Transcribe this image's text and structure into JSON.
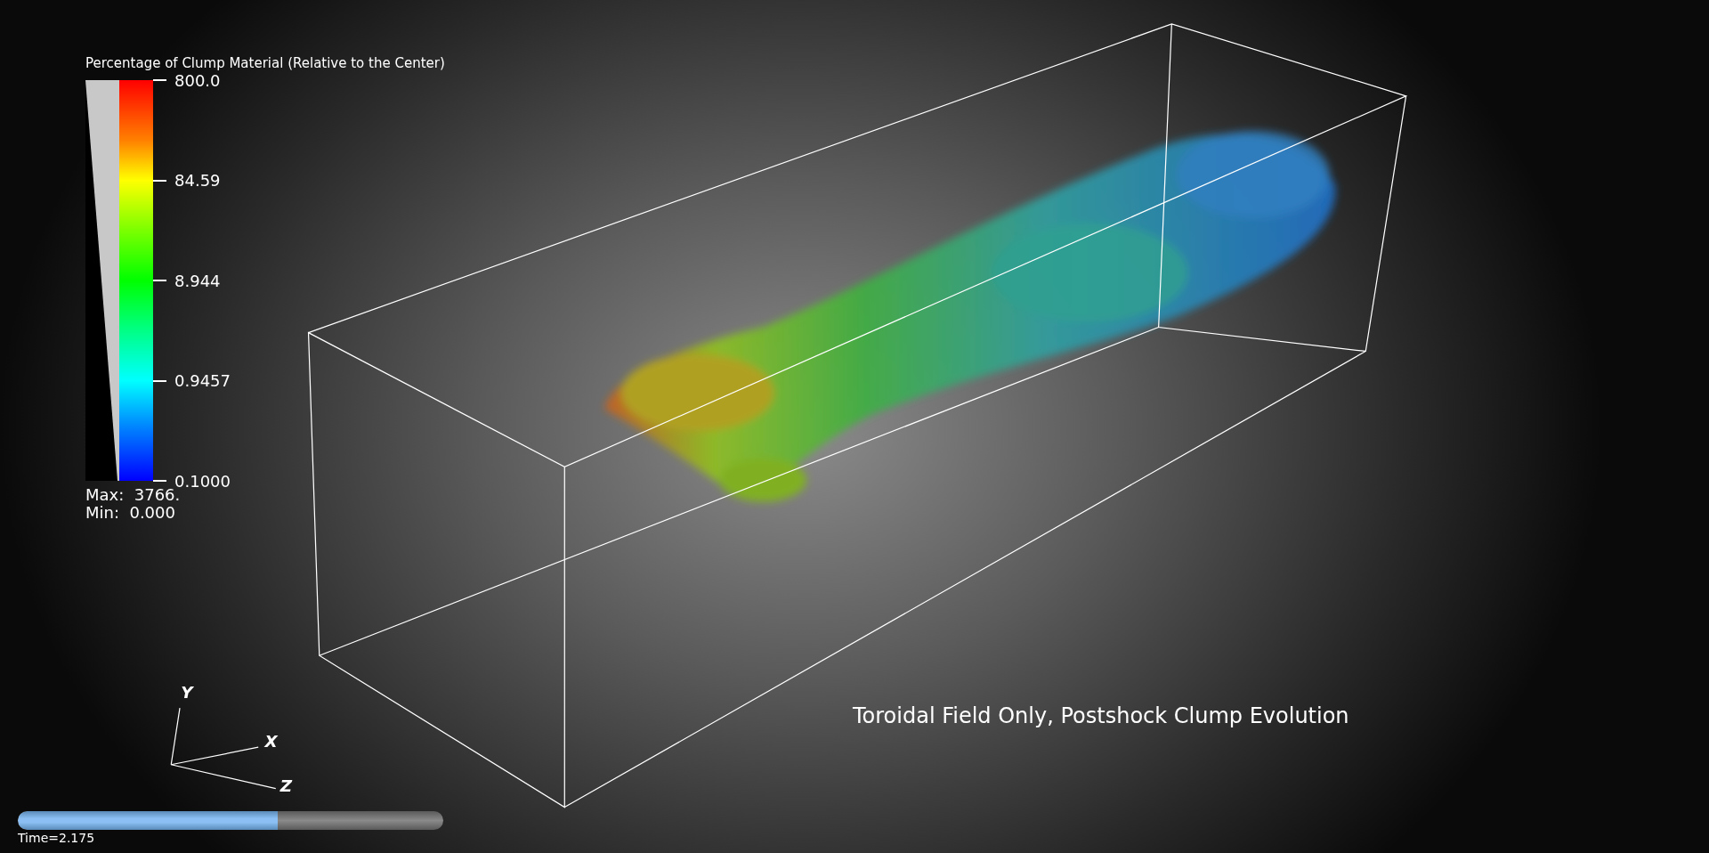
{
  "legend": {
    "title": "Percentage of Clump Material (Relative to the Center)",
    "ticks": [
      {
        "label": "800.0"
      },
      {
        "label": "84.59"
      },
      {
        "label": "8.944"
      },
      {
        "label": "0.9457"
      },
      {
        "label": "0.1000"
      }
    ],
    "max_label": "Max:  3766.",
    "min_label": "Min:  0.000"
  },
  "axes": [
    {
      "label": "Y"
    },
    {
      "label": "X"
    },
    {
      "label": "Z"
    }
  ],
  "caption": "Toroidal Field Only, Postshock Clump Evolution",
  "time_slider": {
    "level": 0.61,
    "label": "Time=2.175"
  }
}
